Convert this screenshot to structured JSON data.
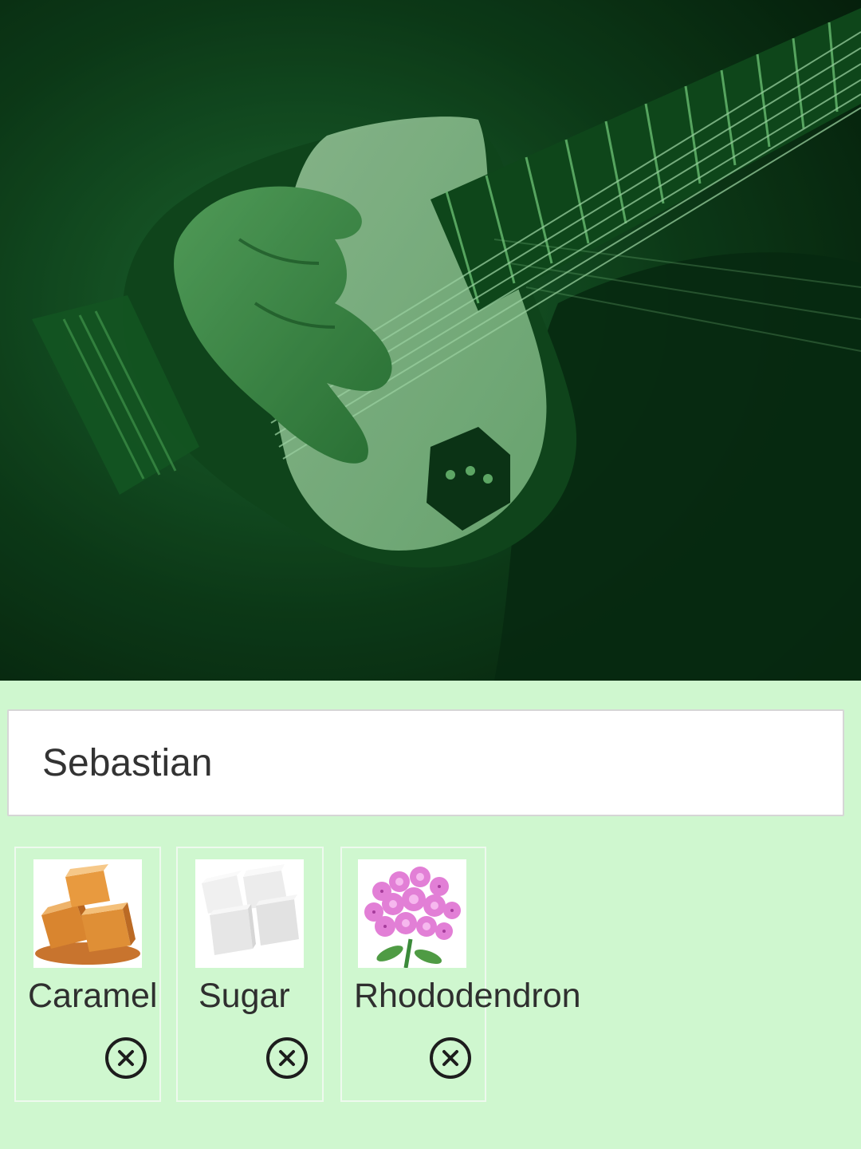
{
  "hero": {
    "photo_subject": "hand strumming an electric guitar, green tint",
    "tint_color": "#1c7a35"
  },
  "name_input": {
    "value": "Sebastian"
  },
  "selected_items": [
    {
      "label": "Caramel",
      "image": "caramel-cubes",
      "remove_icon": "circle-x-icon"
    },
    {
      "label": "Sugar",
      "image": "sugar-cubes",
      "remove_icon": "circle-x-icon"
    },
    {
      "label": "Rhododendron",
      "image": "pink-flower-cluster",
      "remove_icon": "circle-x-icon"
    }
  ],
  "colors": {
    "page_background": "#cff7cf",
    "input_border": "#d6d6d6",
    "card_border": "#eef9ee"
  }
}
